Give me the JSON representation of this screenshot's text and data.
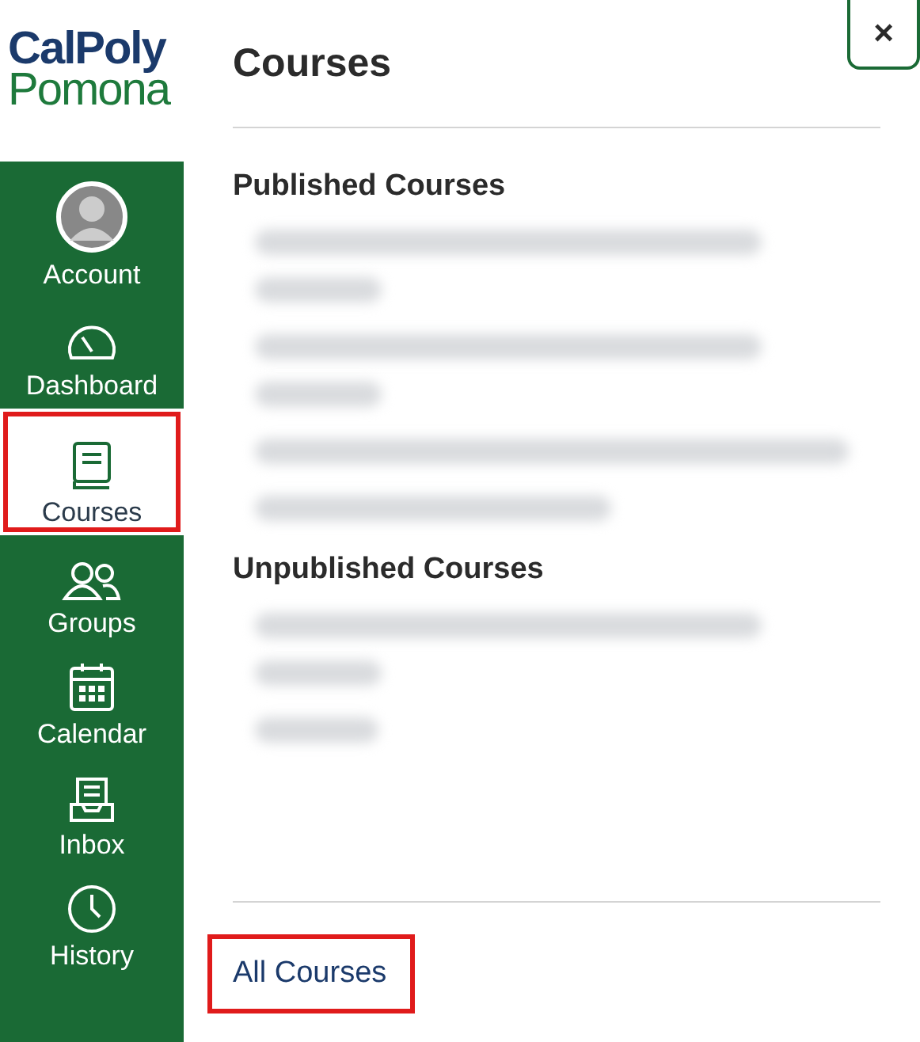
{
  "logo": {
    "line_1": "CalPoly",
    "line_2": "Pomona"
  },
  "nav": [
    {
      "label": "Account",
      "kind": "avatar",
      "selected": false,
      "highlighted": false
    },
    {
      "label": "Dashboard",
      "kind": "gauge",
      "selected": false,
      "highlighted": false
    },
    {
      "label": "Courses",
      "kind": "book",
      "selected": true,
      "highlighted": true
    },
    {
      "label": "Groups",
      "kind": "people",
      "selected": false,
      "highlighted": false
    },
    {
      "label": "Calendar",
      "kind": "calendar",
      "selected": false,
      "highlighted": false
    },
    {
      "label": "Inbox",
      "kind": "inbox",
      "selected": false,
      "highlighted": false
    },
    {
      "label": "History",
      "kind": "clock",
      "selected": false,
      "highlighted": false
    }
  ],
  "tray": {
    "title": "Courses",
    "close": "×",
    "sections": [
      {
        "heading": "Published Courses",
        "items": [
          {
            "kind": "redacted-two-line"
          },
          {
            "kind": "redacted-two-line"
          },
          {
            "kind": "redacted-long"
          },
          {
            "kind": "redacted-short"
          }
        ]
      },
      {
        "heading": "Unpublished Courses",
        "items": [
          {
            "kind": "redacted-two-line"
          },
          {
            "kind": "redacted-tiny"
          }
        ]
      }
    ],
    "all_link": {
      "label": "All Courses",
      "highlighted": true
    }
  }
}
